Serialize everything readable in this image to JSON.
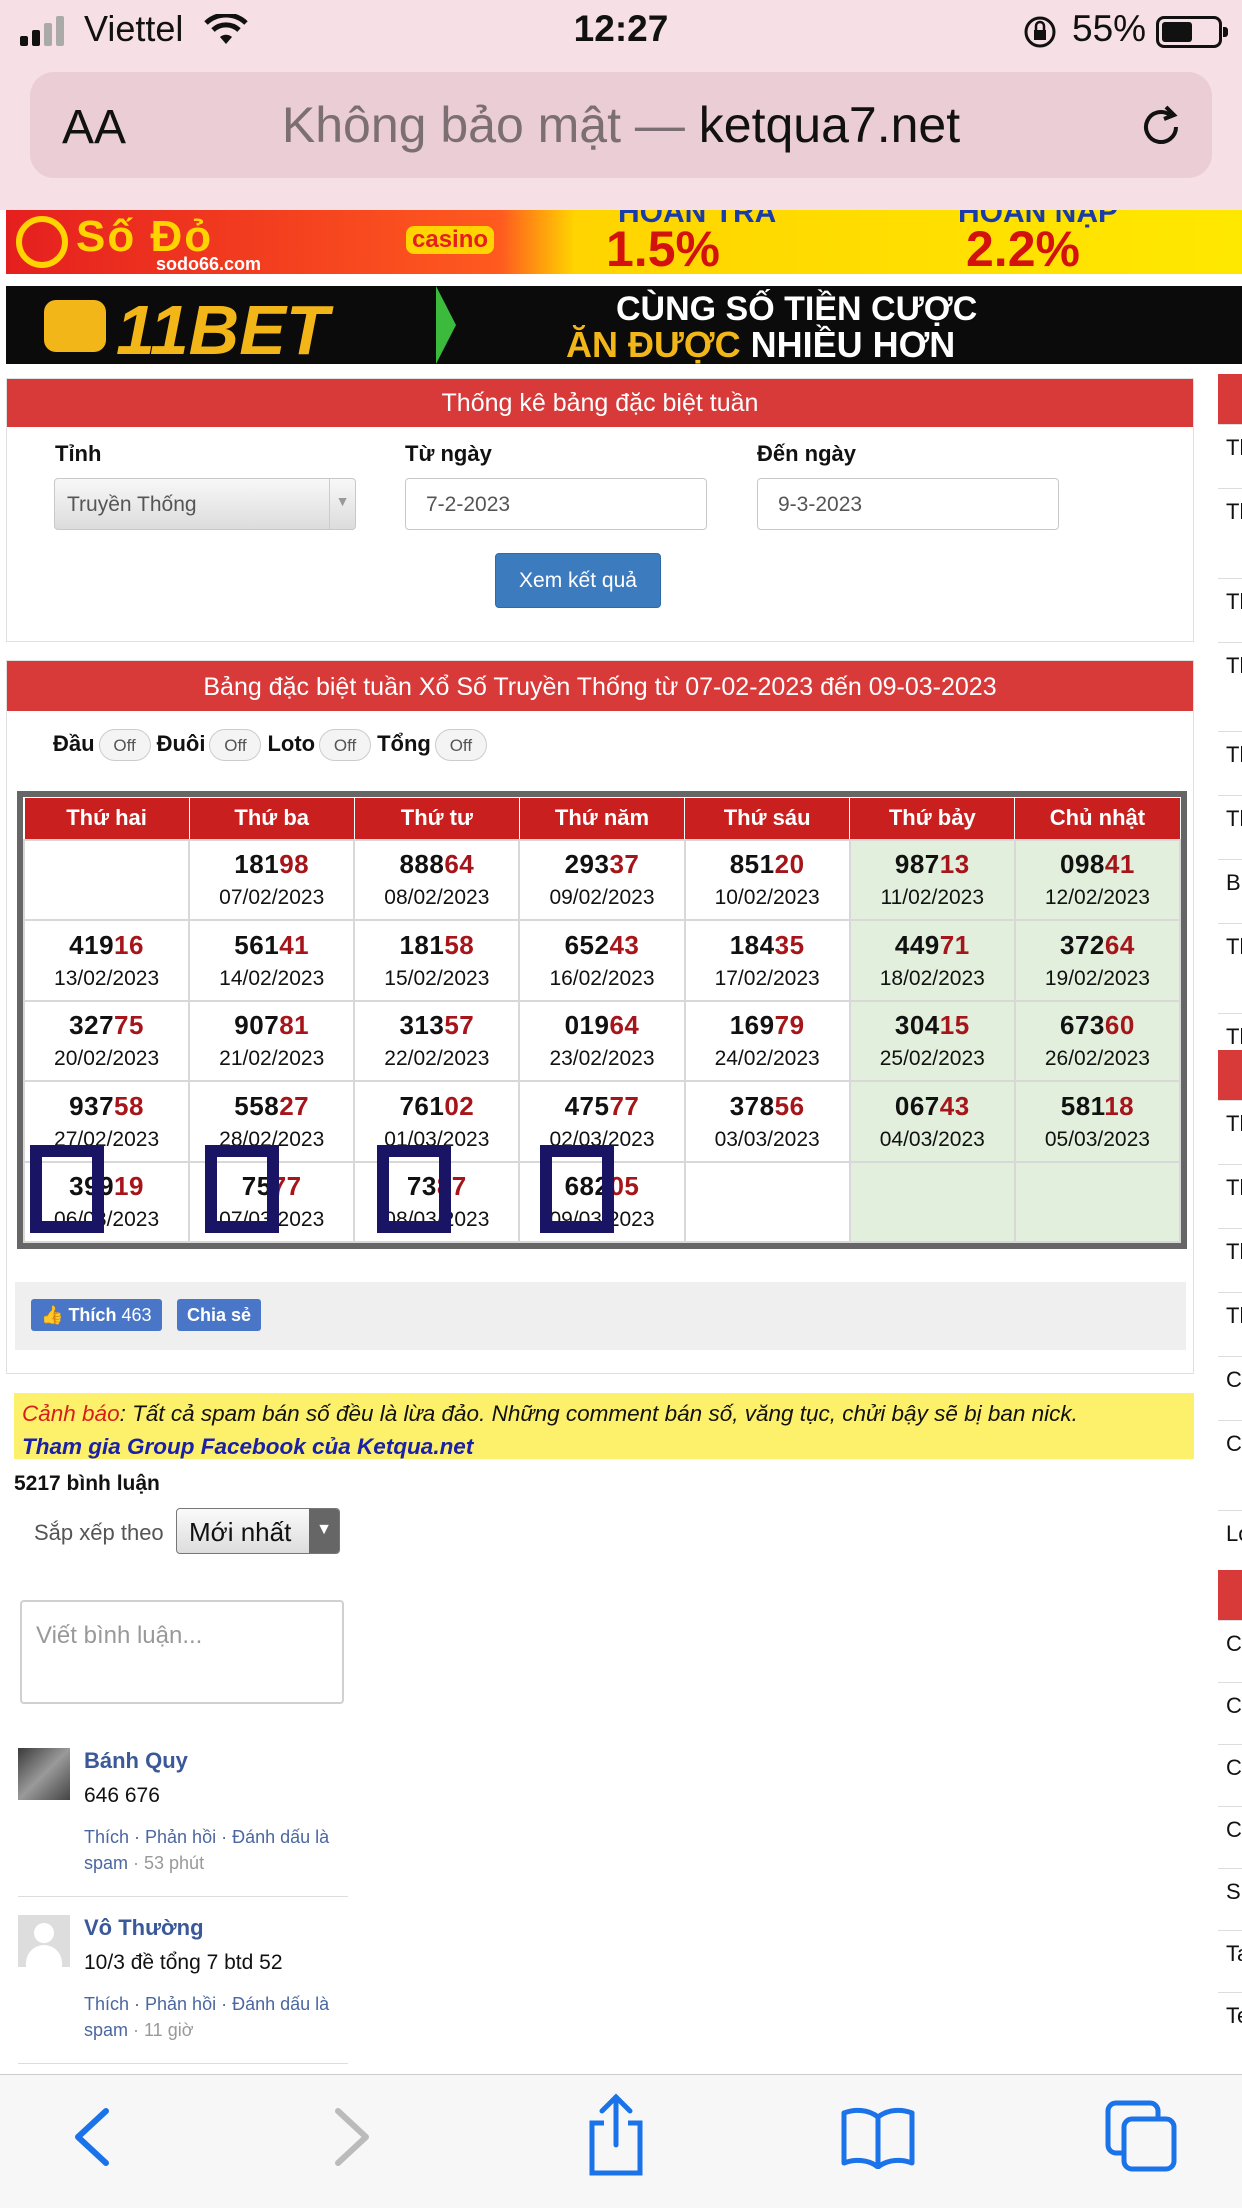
{
  "status": {
    "carrier": "Viettel",
    "time": "12:27",
    "battery": "55%"
  },
  "browser": {
    "aa": "AA",
    "insecure": "Không bảo mật —",
    "domain": "ketqua7.net"
  },
  "banner1": {
    "brand": "Số Đỏ",
    "badge": "casino",
    "site": "sodo66.com",
    "label1": "HOÀN TRẢ",
    "val1": "1.5%",
    "label2": "HOÀN NẠP",
    "val2": "2.2%"
  },
  "banner2": {
    "brand": "11BET",
    "line1": "CÙNG SỐ TIỀN CƯỢC",
    "line2a": "ĂN ĐƯỢC",
    "line2b": " NHIỀU HƠN"
  },
  "filter": {
    "title": "Thống kê bảng đặc biệt tuần",
    "province_label": "Tỉnh",
    "province_value": "Truyền Thống",
    "from_label": "Từ ngày",
    "from_value": "7-2-2023",
    "to_label": "Đến ngày",
    "to_value": "9-3-2023",
    "submit": "Xem kết quả"
  },
  "results": {
    "title": "Bảng đặc biệt tuần Xổ Số Truyền Thống từ 07-02-2023 đến 09-03-2023",
    "toggles": [
      {
        "label": "Đầu",
        "state": "Off"
      },
      {
        "label": "Đuôi",
        "state": "Off"
      },
      {
        "label": "Loto",
        "state": "Off"
      },
      {
        "label": "Tổng",
        "state": "Off"
      }
    ],
    "days": [
      "Thứ hai",
      "Thứ ba",
      "Thứ tư",
      "Thứ năm",
      "Thứ sáu",
      "Thứ bảy",
      "Chủ nhật"
    ],
    "rows": [
      [
        null,
        {
          "a": "181",
          "b": "98",
          "d": "07/02/2023"
        },
        {
          "a": "888",
          "b": "64",
          "d": "08/02/2023"
        },
        {
          "a": "293",
          "b": "37",
          "d": "09/02/2023"
        },
        {
          "a": "851",
          "b": "20",
          "d": "10/02/2023"
        },
        {
          "a": "987",
          "b": "13",
          "d": "11/02/2023"
        },
        {
          "a": "098",
          "b": "41",
          "d": "12/02/2023"
        }
      ],
      [
        {
          "a": "419",
          "b": "16",
          "d": "13/02/2023"
        },
        {
          "a": "561",
          "b": "41",
          "d": "14/02/2023"
        },
        {
          "a": "181",
          "b": "58",
          "d": "15/02/2023"
        },
        {
          "a": "652",
          "b": "43",
          "d": "16/02/2023"
        },
        {
          "a": "184",
          "b": "35",
          "d": "17/02/2023"
        },
        {
          "a": "449",
          "b": "71",
          "d": "18/02/2023"
        },
        {
          "a": "372",
          "b": "64",
          "d": "19/02/2023"
        }
      ],
      [
        {
          "a": "327",
          "b": "75",
          "d": "20/02/2023"
        },
        {
          "a": "907",
          "b": "81",
          "d": "21/02/2023"
        },
        {
          "a": "313",
          "b": "57",
          "d": "22/02/2023"
        },
        {
          "a": "019",
          "b": "64",
          "d": "23/02/2023"
        },
        {
          "a": "169",
          "b": "79",
          "d": "24/02/2023"
        },
        {
          "a": "304",
          "b": "15",
          "d": "25/02/2023"
        },
        {
          "a": "673",
          "b": "60",
          "d": "26/02/2023"
        }
      ],
      [
        {
          "a": "937",
          "b": "58",
          "d": "27/02/2023"
        },
        {
          "a": "558",
          "b": "27",
          "d": "28/02/2023"
        },
        {
          "a": "761",
          "b": "02",
          "d": "01/03/2023"
        },
        {
          "a": "475",
          "b": "77",
          "d": "02/03/2023"
        },
        {
          "a": "378",
          "b": "56",
          "d": "03/03/2023"
        },
        {
          "a": "067",
          "b": "43",
          "d": "04/03/2023"
        },
        {
          "a": "581",
          "b": "18",
          "d": "05/03/2023"
        }
      ],
      [
        {
          "a": "399",
          "b": "19",
          "d": "06/03/2023"
        },
        {
          "a": "75",
          "b": "77",
          "d": "07/03/2023"
        },
        {
          "a": "73",
          "b": "87",
          "d": "08/03/2023"
        },
        {
          "a": "682",
          "b": "05",
          "d": "09/03/2023"
        },
        null,
        null,
        null
      ]
    ]
  },
  "social": {
    "like": "Thích",
    "like_count": "463",
    "share": "Chia sẻ"
  },
  "warning": {
    "prefix": "Cảnh báo",
    "text": ": Tất cả spam bán số đều là lừa đảo. Những comment bán số, văng tục, chửi bậy sẽ bị ban nick.",
    "link": "Tham gia Group Facebook của Ketqua.net"
  },
  "comments": {
    "count": "5217 bình luận",
    "sort_label": "Sắp xếp theo",
    "sort_value": "Mới nhất",
    "placeholder": "Viết bình luận...",
    "items": [
      {
        "name": "Bánh Quy",
        "text": "646 676",
        "actions": "Thích · Phản hồi · Đánh dấu là spam",
        "time": " · 53 phút"
      },
      {
        "name": "Vô Thường",
        "text": "10/3 đề tổng 7 btd 52",
        "actions": "Thích · Phản hồi · Đánh dấu là spam",
        "time": " · 11 giờ"
      }
    ]
  },
  "sidebar": {
    "rows1": [
      "Tl",
      "Tl lo",
      "Tl",
      "Tl lo",
      "Tl",
      "Tl",
      "B",
      "Tl th",
      "Tl"
    ],
    "rows2": [
      "Tl",
      "Tl",
      "Tl",
      "Tl",
      "C",
      "C V",
      "Lo"
    ],
    "rows3": [
      "C",
      "C",
      "C",
      "C",
      "S",
      "Ta",
      "Te"
    ]
  },
  "colors": {
    "header_red": "#d83a3a",
    "table_head": "#c9201f",
    "highlight": "#a5151a",
    "weekend": "#e1efdc",
    "button": "#3d7bbf",
    "link": "#3b5998"
  }
}
